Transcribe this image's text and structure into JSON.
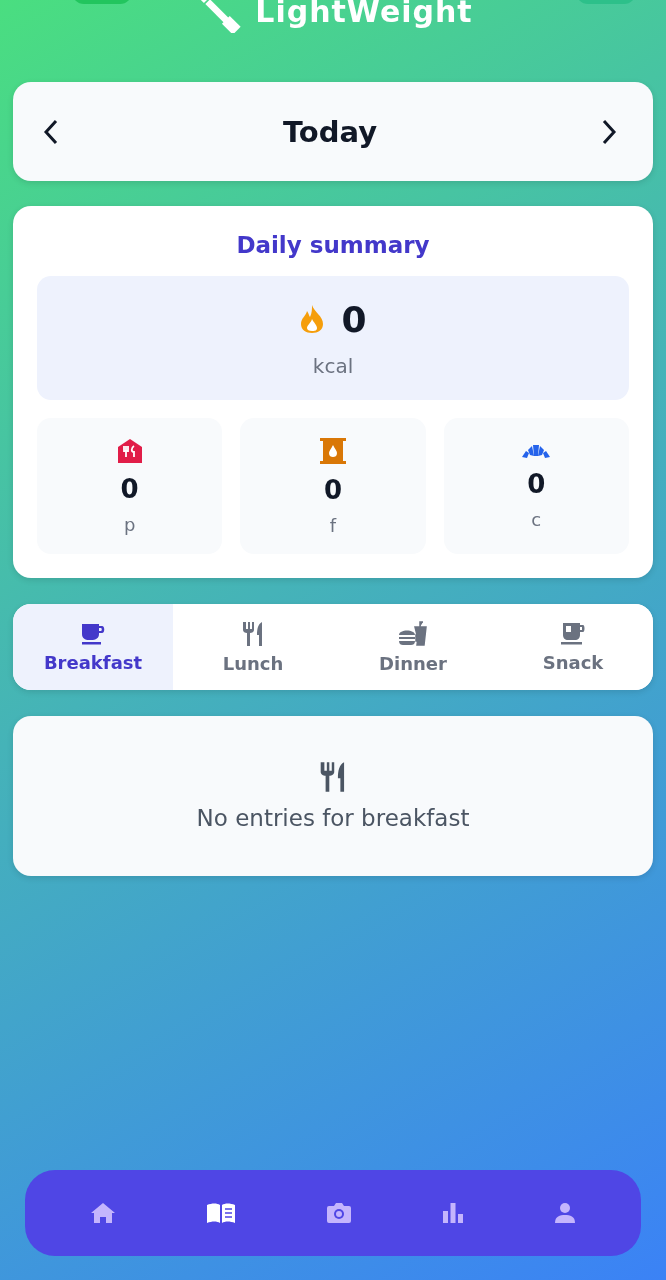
{
  "app_title": "LightWeight",
  "date_nav": {
    "label": "Today"
  },
  "summary": {
    "title": "Daily summary",
    "calories": {
      "value": "0",
      "unit": "kcal"
    },
    "macros": [
      {
        "kind": "protein",
        "value": "0",
        "label": "p"
      },
      {
        "kind": "fat",
        "value": "0",
        "label": "f"
      },
      {
        "kind": "carbs",
        "value": "0",
        "label": "c"
      }
    ]
  },
  "meal_tabs": [
    {
      "kind": "breakfast",
      "label": "Breakfast",
      "selected": true
    },
    {
      "kind": "lunch",
      "label": "Lunch",
      "selected": false
    },
    {
      "kind": "dinner",
      "label": "Dinner",
      "selected": false
    },
    {
      "kind": "snack",
      "label": "Snack",
      "selected": false
    }
  ],
  "empty_state": {
    "message": "No entries for breakfast"
  },
  "bottom_nav": [
    {
      "kind": "home",
      "selected": false
    },
    {
      "kind": "diary",
      "selected": true
    },
    {
      "kind": "camera",
      "selected": false
    },
    {
      "kind": "stats",
      "selected": false
    },
    {
      "kind": "profile",
      "selected": false
    }
  ]
}
